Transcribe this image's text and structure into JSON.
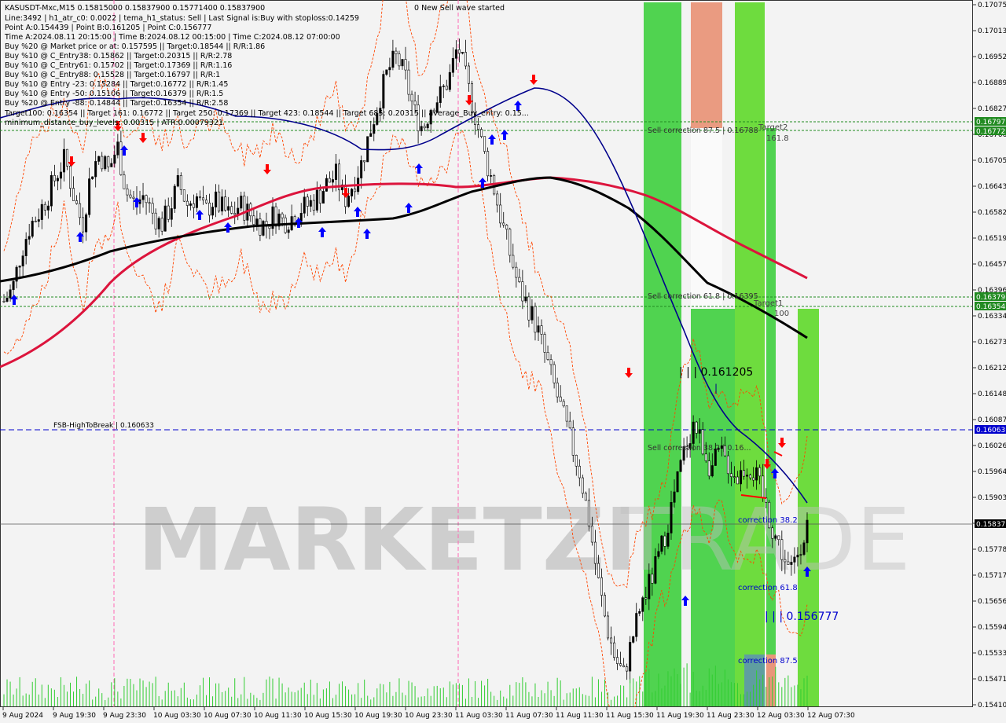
{
  "header": {
    "symbol_line": "KASUSDT-Mxc,M15  0.15815000 0.15837900 0.15771400 0.15837900",
    "lines": [
      "Line:3492 | h1_atr_c0: 0.0022 | tema_h1_status: Sell | Last Signal is:Buy with stoploss:0.14259",
      "Point A:0.154439 | Point B:0.161205 | Point C:0.156777",
      "Time A:2024.08.11 20:15:00 | Time B:2024.08.12 00:15:00 | Time C:2024.08.12 07:00:00",
      "Buy %20 @ Market price or at: 0.157595 || Target:0.18544 || R/R:1.86",
      "Buy %10 @ C_Entry38: 0.15862 || Target:0.20315 || R/R:2.78",
      "Buy %10 @ C_Entry61: 0.15702 || Target:0.17369 || R/R:1.16",
      "Buy %10 @ C_Entry88: 0.15528 || Target:0.16797 || R/R:1",
      "Buy %10 @ Entry -23: 0.15284 || Target:0.16772 || R/R:1.45",
      "Buy %10 @ Entry -50: 0.15106 || Target:0.16379 || R/R:1.5",
      "Buy %20 @ Entry -88: 0.14844 || Target:0.16354 || R/R:2.58",
      "Target100: 0.16354 || Target 161: 0.16772 || Target 250: 0.17369 || Target 423: 0.18544 || Target 685: 0.20315 || average_Buy_entry: 0.15...",
      "minimum_distance_buy_levels: 0.00315 | ATR:0.00079321"
    ],
    "wave_status": "0 New Sell wave started"
  },
  "watermark": {
    "text1": "MARKETZI",
    "text2": "TRADE"
  },
  "annotations": {
    "fsb": "FSB-HighToBreak | 0.160633",
    "sell_corr_875": "Sell correction 87.5 | 0.16788",
    "sell_corr_618": "Sell correction 61.8 | 0.16395",
    "sell_corr_382": "Sell correction 38.2 | 0.16...",
    "target2": "Target2",
    "target2_val": "161.8",
    "target1": "Target1",
    "target1_val": "100",
    "point_b": "| | | 0.161205",
    "point_b_mark": "|",
    "point_c": "| | | 0.156777",
    "corr_382": "correction 38.2",
    "corr_618": "correction 61.8",
    "corr_875": "correction 87.5"
  },
  "price_tags": {
    "t1": "0.16797",
    "t2": "0.16772",
    "t3": "0.16379",
    "t4": "0.16354",
    "t5": "0.16063",
    "t6": "0.15837"
  },
  "colors": {
    "background": "#f3f3f3",
    "ma_red": "#dc143c",
    "ma_black": "#000000",
    "ma_blue": "#00008b",
    "envelope": "#ff4500",
    "green_zone": "#32cd32",
    "orange_zone": "#e9967a",
    "teal_zone": "#5f9ea0",
    "buy_arrow": "#0000ff",
    "sell_arrow": "#ff0000",
    "level_green": "#228b22",
    "level_blue": "#0000cd"
  },
  "chart_data": {
    "type": "candlestick",
    "symbol": "KASUSDT-Mxc",
    "timeframe": "M15",
    "y_ticks": [
      "0.17075",
      "0.17013",
      "0.16952",
      "0.16889",
      "0.16827",
      "0.16766",
      "0.16705",
      "0.16643",
      "0.16582",
      "0.16519",
      "0.16457",
      "0.16396",
      "0.16334",
      "0.16273",
      "0.16212",
      "0.16148",
      "0.16087",
      "0.16026",
      "0.15964",
      "0.15903",
      "0.15841",
      "0.15778",
      "0.15717",
      "0.15656",
      "0.15594",
      "0.15533",
      "0.15471",
      "0.15410"
    ],
    "x_ticks": [
      "9 Aug 2024",
      "9 Aug 19:30",
      "9 Aug 23:30",
      "10 Aug 03:30",
      "10 Aug 07:30",
      "10 Aug 11:30",
      "10 Aug 15:30",
      "10 Aug 19:30",
      "10 Aug 23:30",
      "11 Aug 03:30",
      "11 Aug 07:30",
      "11 Aug 11:30",
      "11 Aug 15:30",
      "11 Aug 19:30",
      "11 Aug 23:30",
      "12 Aug 03:30",
      "12 Aug 07:30"
    ],
    "ylim": [
      0.1541,
      0.17075
    ],
    "levels": [
      {
        "name": "fsb_high_to_break",
        "value": 0.160633
      },
      {
        "name": "target2",
        "value": 0.16797
      },
      {
        "name": "target2b",
        "value": 0.16772
      },
      {
        "name": "target1",
        "value": 0.16379
      },
      {
        "name": "target1b",
        "value": 0.16354
      },
      {
        "name": "current",
        "value": 0.15837
      }
    ],
    "close_path": [
      0.1637,
      0.164,
      0.1649,
      0.1655,
      0.1658,
      0.1662,
      0.1667,
      0.1671,
      0.1662,
      0.1655,
      0.1668,
      0.1672,
      0.1668,
      0.1674,
      0.1663,
      0.166,
      0.1662,
      0.1658,
      0.1655,
      0.1659,
      0.1665,
      0.166,
      0.1662,
      0.1658,
      0.1661,
      0.1659,
      0.1657,
      0.166,
      0.1658,
      0.1656,
      0.1655,
      0.1658,
      0.1656,
      0.1657,
      0.1659,
      0.166,
      0.1662,
      0.1665,
      0.1667,
      0.1661,
      0.1665,
      0.167,
      0.1678,
      0.1685,
      0.1692,
      0.1695,
      0.169,
      0.1682,
      0.1678,
      0.1684,
      0.1686,
      0.169,
      0.1698,
      0.1689,
      0.1681,
      0.1672,
      0.1665,
      0.1656,
      0.1648,
      0.164,
      0.1636,
      0.1631,
      0.1624,
      0.1617,
      0.161,
      0.1603,
      0.1596,
      0.1585,
      0.1571,
      0.156,
      0.1552,
      0.1548,
      0.1557,
      0.1565,
      0.157,
      0.1576,
      0.1584,
      0.1593,
      0.1602,
      0.1608,
      0.1603,
      0.1597,
      0.1601,
      0.1598,
      0.1595,
      0.1598,
      0.1596,
      0.159,
      0.1583,
      0.1578,
      0.1572,
      0.1578,
      0.1584
    ]
  }
}
